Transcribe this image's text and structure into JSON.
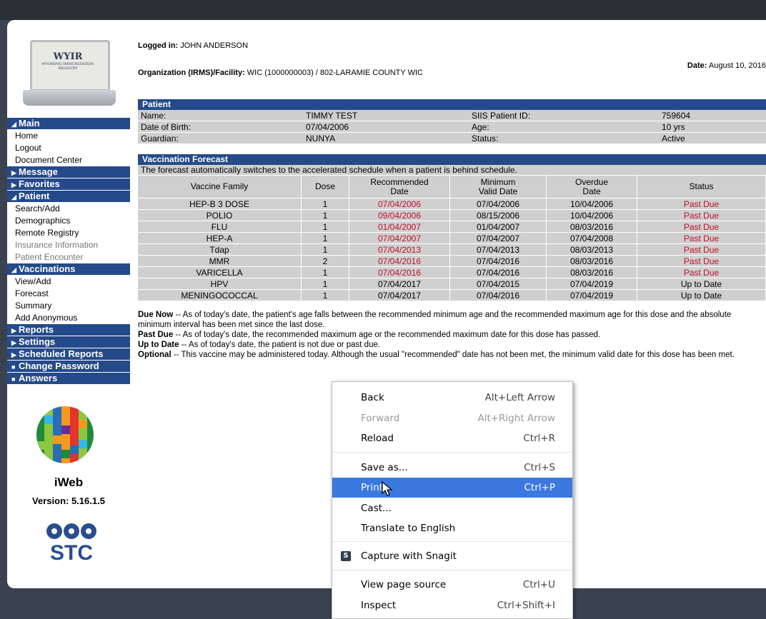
{
  "header": {
    "logged_in_label": "Logged in:",
    "logged_in_user": "JOHN ANDERSON",
    "org_label": "Organization (IRMS)/Facility:",
    "org_value": "WIC (1000000003) / 802-LARAMIE COUNTY WIC",
    "date_label": "Date:",
    "date_value": "August 10, 2016"
  },
  "logo": {
    "title": "WYIR",
    "subtitle": "WYOMING IMMUNIZATION REGISTRY"
  },
  "sidebar": {
    "main": "Main",
    "home": "Home",
    "logout": "Logout",
    "document_center": "Document Center",
    "message": "Message",
    "favorites": "Favorites",
    "patient": "Patient",
    "search_add": "Search/Add",
    "demographics": "Demographics",
    "remote_registry": "Remote Registry",
    "insurance_information": "Insurance Information",
    "patient_encounter": "Patient Encounter",
    "vaccinations": "Vaccinations",
    "view_add": "View/Add",
    "forecast": "Forecast",
    "summary": "Summary",
    "add_anonymous": "Add Anonymous",
    "reports": "Reports",
    "settings": "Settings",
    "scheduled_reports": "Scheduled Reports",
    "change_password": "Change Password",
    "answers": "Answers"
  },
  "brand": {
    "iweb": "iWeb",
    "version": "Version: 5.16.1.5",
    "stc": "STC"
  },
  "patient": {
    "title": "Patient",
    "name_label": "Name:",
    "name": "TIMMY TEST",
    "id_label": "SIIS Patient ID:",
    "id": "759604",
    "dob_label": "Date of Birth:",
    "dob": "07/04/2006",
    "age_label": "Age:",
    "age": "10 yrs",
    "guardian_label": "Guardian:",
    "guardian": "NUNYA",
    "status_label": "Status:",
    "status": "Active"
  },
  "forecast": {
    "title": "Vaccination Forecast",
    "note": "The forecast automatically switches to the accelerated schedule when a patient is behind schedule.",
    "headers": {
      "family": "Vaccine Family",
      "dose": "Dose",
      "rec1": "Recommended",
      "rec2": "Date",
      "min1": "Minimum",
      "min2": "Valid Date",
      "over1": "Overdue",
      "over2": "Date",
      "status": "Status"
    },
    "rows": [
      {
        "family": "HEP-B 3 DOSE",
        "dose": "1",
        "rec": "07/04/2006",
        "min": "07/04/2006",
        "over": "10/04/2006",
        "status": "Past Due"
      },
      {
        "family": "POLIO",
        "dose": "1",
        "rec": "09/04/2006",
        "min": "08/15/2006",
        "over": "10/04/2006",
        "status": "Past Due"
      },
      {
        "family": "FLU",
        "dose": "1",
        "rec": "01/04/2007",
        "min": "01/04/2007",
        "over": "08/03/2016",
        "status": "Past Due"
      },
      {
        "family": "HEP-A",
        "dose": "1",
        "rec": "07/04/2007",
        "min": "07/04/2007",
        "over": "07/04/2008",
        "status": "Past Due"
      },
      {
        "family": "Tdap",
        "dose": "1",
        "rec": "07/04/2013",
        "min": "07/04/2013",
        "over": "08/03/2013",
        "status": "Past Due"
      },
      {
        "family": "MMR",
        "dose": "2",
        "rec": "07/04/2016",
        "min": "07/04/2016",
        "over": "08/03/2016",
        "status": "Past Due"
      },
      {
        "family": "VARICELLA",
        "dose": "1",
        "rec": "07/04/2016",
        "min": "07/04/2016",
        "over": "08/03/2016",
        "status": "Past Due"
      },
      {
        "family": "HPV",
        "dose": "1",
        "rec": "07/04/2017",
        "min": "07/04/2015",
        "over": "07/04/2019",
        "status": "Up to Date"
      },
      {
        "family": "MENINGOCOCCAL",
        "dose": "1",
        "rec": "07/04/2017",
        "min": "07/04/2016",
        "over": "07/04/2019",
        "status": "Up to Date"
      }
    ]
  },
  "legend": {
    "due_now_term": "Due Now",
    "due_now_text": " -- As of today's date, the patient's age falls between the recommended minimum age and the recommended maximum age for this dose and the absolute minimum interval has been met since the last dose.",
    "past_due_term": "Past Due",
    "past_due_text": " -- As of today's date, the recommended maximum age or the recommended maximum date for this dose has passed.",
    "up_to_date_term": "Up to Date",
    "up_to_date_text": " -- As of today's date, the patient is not due or past due.",
    "optional_term": "Optional",
    "optional_text": " -- This vaccine may be administered today. Although the usual \"recommended\" date has not been met, the minimum valid date for this dose has been met."
  },
  "context_menu": {
    "back": "Back",
    "back_key": "Alt+Left Arrow",
    "forward": "Forward",
    "forward_key": "Alt+Right Arrow",
    "reload": "Reload",
    "reload_key": "Ctrl+R",
    "save_as": "Save as...",
    "save_as_key": "Ctrl+S",
    "print": "Print...",
    "print_key": "Ctrl+P",
    "cast": "Cast...",
    "translate": "Translate to English",
    "snagit": "Capture with Snagit",
    "view_source": "View page source",
    "view_source_key": "Ctrl+U",
    "inspect": "Inspect",
    "inspect_key": "Ctrl+Shift+I"
  },
  "colors": {
    "nav_blue": "#254a89",
    "past_due_red": "#c0112a",
    "menu_highlight": "#3b78e0",
    "cell_gray": "#cfcfcf"
  }
}
